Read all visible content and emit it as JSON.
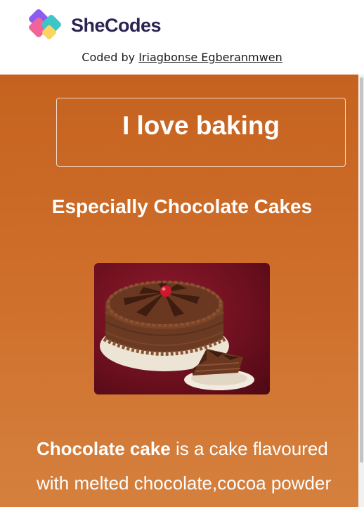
{
  "header": {
    "logo_text": "SheCodes",
    "credit_prefix": "Coded by ",
    "credit_author": "Iriagbonse Egberanmwen"
  },
  "main": {
    "title": "I love baking",
    "subtitle": "Especially Chocolate Cakes",
    "image_subject": "chocolate-cake-photo",
    "description_bold": "Chocolate cake",
    "description_rest": " is a cake flavoured with melted chocolate,cocoa powder"
  },
  "colors": {
    "panel_top": "#c5621f",
    "panel_bottom": "#d5803e",
    "logo_text": "#2a2452",
    "logo_pink": "#f2639a",
    "logo_purple": "#8c5cf1",
    "logo_teal": "#3ec5c8",
    "logo_yellow": "#fcd463"
  }
}
